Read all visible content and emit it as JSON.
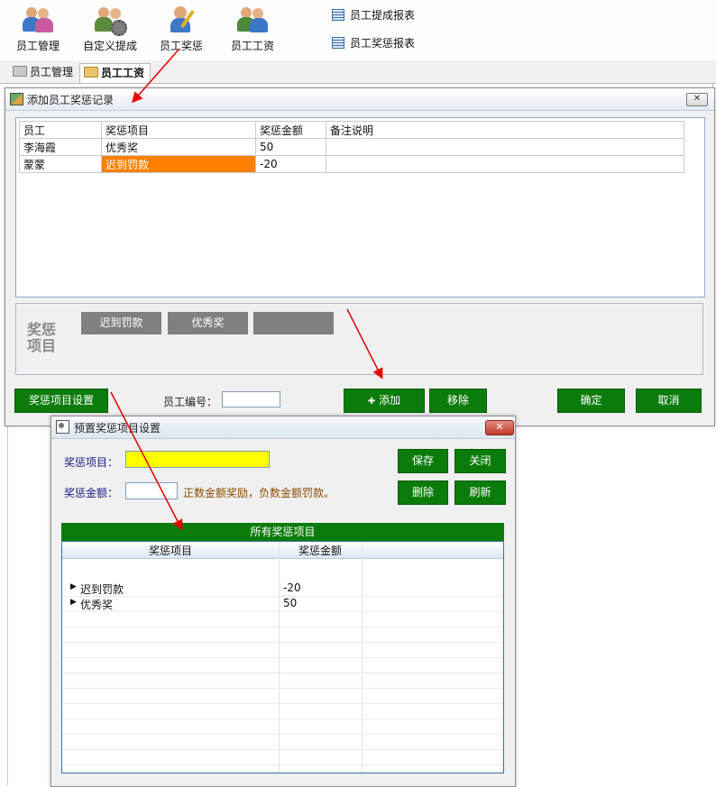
{
  "toolbar": {
    "buttons": [
      {
        "label": "员工管理",
        "icon": "users-icon"
      },
      {
        "label": "自定义提成",
        "icon": "users-gear-icon"
      },
      {
        "label": "员工奖惩",
        "icon": "user-edit-icon"
      },
      {
        "label": "员工工资",
        "icon": "users-money-icon"
      }
    ],
    "reports": [
      {
        "label": "员工提成报表",
        "icon": "report-icon"
      },
      {
        "label": "员工奖惩报表",
        "icon": "report-icon"
      }
    ]
  },
  "tabs": [
    {
      "label": "员工管理",
      "active": false
    },
    {
      "label": "员工工资",
      "active": true
    }
  ],
  "dialog": {
    "title": "添加员工奖惩记录",
    "close_symbol": "✕",
    "grid": {
      "columns": [
        "员工",
        "奖惩项目",
        "奖惩金额",
        "备注说明"
      ],
      "rows": [
        {
          "employee": "李海霞",
          "item": "优秀奖",
          "amount": "50",
          "note": ""
        },
        {
          "employee": "蒙蒙",
          "item": "迟到罚款",
          "amount": "-20",
          "note": ""
        }
      ]
    },
    "items_panel": {
      "title": "奖惩项目",
      "buttons": [
        "迟到罚款",
        "优秀奖",
        ""
      ]
    },
    "settings_button": "奖惩项目设置",
    "employee_no_label": "员工编号：",
    "employee_no_value": "",
    "add_button": "添加",
    "add_symbol": "✚",
    "remove_button": "移除",
    "ok_button": "确定",
    "cancel_button": "取消"
  },
  "dialog2": {
    "title": "预置奖惩项目设置",
    "close_symbol": "✕",
    "item_label": "奖惩项目：",
    "item_value": "",
    "amount_label": "奖惩金额：",
    "amount_value": "",
    "hint": "正数金额奖励，负数金额罚款。",
    "save_button": "保存",
    "close_button": "关闭",
    "delete_button": "删除",
    "refresh_button": "刷新",
    "grid_title": "所有奖惩项目",
    "grid_columns": [
      "奖惩项目",
      "奖惩金额"
    ],
    "grid_rows": [
      {
        "item": "迟到罚款",
        "amount": "-20"
      },
      {
        "item": "优秀奖",
        "amount": "50"
      }
    ]
  },
  "colors": {
    "green": "#0b7c0b",
    "highlight_orange": "#ff8000",
    "input_yellow": "#ffff00",
    "arrow_red": "#e60000"
  }
}
